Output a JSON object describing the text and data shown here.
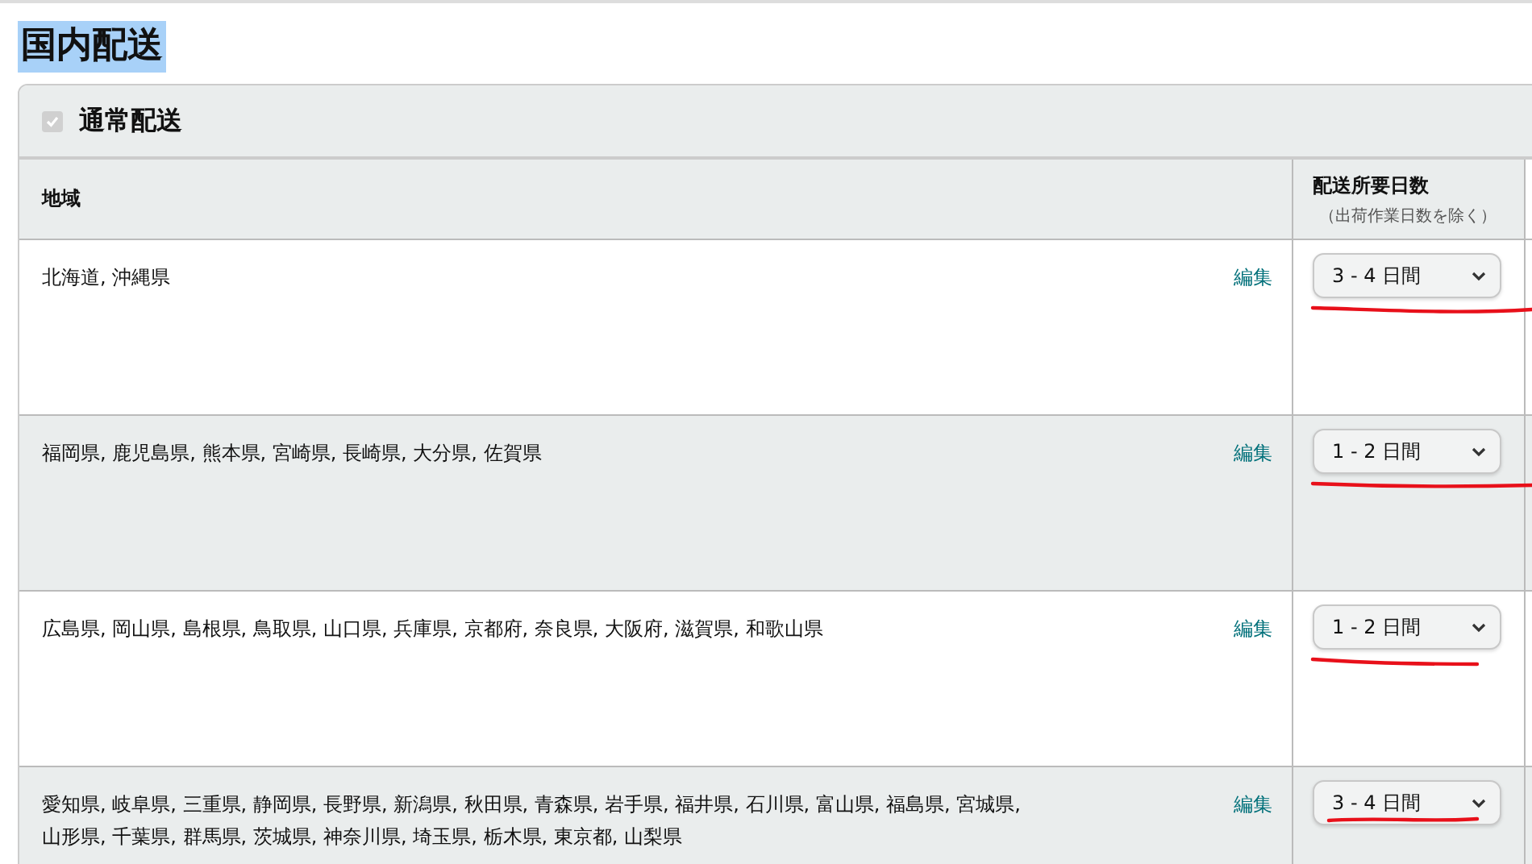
{
  "title": {
    "text": "国内配送",
    "highlighted": true
  },
  "section": {
    "label": "通常配送",
    "checked": true,
    "disabled": true
  },
  "table": {
    "columns": [
      {
        "label": "地域"
      },
      {
        "label": "配送所要日数",
        "note": "（出荷作業日数を除く）"
      }
    ],
    "rows": [
      {
        "regions": "北海道, 沖縄県",
        "action": "編集",
        "days": "3 - 4 日間",
        "underlined": true
      },
      {
        "regions": "福岡県, 鹿児島県, 熊本県, 宮崎県, 長崎県, 大分県, 佐賀県",
        "action": "編集",
        "days": "1 - 2 日間",
        "underlined": true
      },
      {
        "regions": "広島県, 岡山県, 島根県, 鳥取県, 山口県, 兵庫県, 京都府, 奈良県, 大阪府, 滋賀県, 和歌山県",
        "action": "編集",
        "days": "1 - 2 日間",
        "underlined": true
      },
      {
        "regions": "愛知県, 岐阜県, 三重県, 静岡県, 長野県, 新潟県, 秋田県, 青森県, 岩手県, 福井県, 石川県, 富山県, 福島県, 宮城県, 山形県, 千葉県, 群馬県, 茨城県, 神奈川県, 埼玉県, 栃木県, 東京都, 山梨県",
        "action": "編集",
        "days": "3 - 4 日間",
        "underlined": true
      }
    ]
  }
}
